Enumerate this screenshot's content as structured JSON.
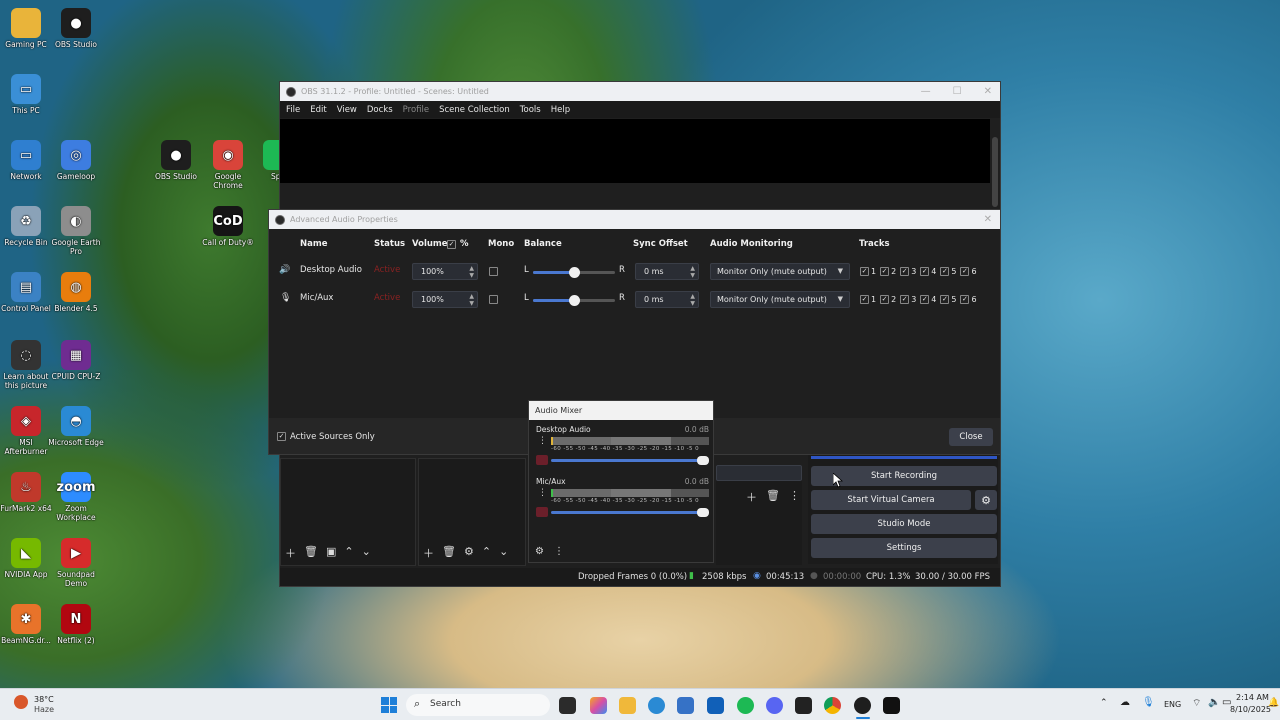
{
  "desktop_icons": [
    {
      "name": "desktop-icon-gaming-pc",
      "label": "Gaming PC",
      "glyph": "",
      "color": "#e9b43a"
    },
    {
      "name": "desktop-icon-obs-studio-1",
      "label": "OBS Studio",
      "glyph": "●",
      "color": "#1e1e1e"
    },
    {
      "name": "desktop-icon-this-pc",
      "label": "This PC",
      "glyph": "▭",
      "color": "#3a8fd6"
    },
    {
      "name": "desktop-icon-network",
      "label": "Network",
      "glyph": "▭",
      "color": "#2f7fd0"
    },
    {
      "name": "desktop-icon-gameloop",
      "label": "Gameloop",
      "glyph": "◎",
      "color": "#3d7de0"
    },
    {
      "name": "desktop-icon-obs-studio-2",
      "label": "OBS Studio",
      "glyph": "●",
      "color": "#1e1e1e"
    },
    {
      "name": "desktop-icon-google-chrome",
      "label": "Google Chrome",
      "glyph": "◉",
      "color": "#d9443a"
    },
    {
      "name": "desktop-icon-recycle-bin",
      "label": "Recycle Bin",
      "glyph": "♻",
      "color": "#8aa2b8"
    },
    {
      "name": "desktop-icon-google-earth-pro",
      "label": "Google Earth Pro",
      "glyph": "◐",
      "color": "#8d8d8d"
    },
    {
      "name": "desktop-icon-call-of-duty",
      "label": "Call of Duty®",
      "glyph": "CoD",
      "color": "#151515"
    },
    {
      "name": "desktop-icon-control-panel",
      "label": "Control Panel",
      "glyph": "▤",
      "color": "#3b82c4"
    },
    {
      "name": "desktop-icon-blender",
      "label": "Blender 4.5",
      "glyph": "◍",
      "color": "#e87d0d"
    },
    {
      "name": "desktop-icon-learn-about",
      "label": "Learn about this picture",
      "glyph": "◌",
      "color": "#333333"
    },
    {
      "name": "desktop-icon-cpuid",
      "label": "CPUID CPU-Z",
      "glyph": "▦",
      "color": "#6f2c91"
    },
    {
      "name": "desktop-icon-msi-afterburner",
      "label": "MSI Afterburner",
      "glyph": "◈",
      "color": "#c7262b"
    },
    {
      "name": "desktop-icon-microsoft-edge",
      "label": "Microsoft Edge",
      "glyph": "◓",
      "color": "#2a8ad4"
    },
    {
      "name": "desktop-icon-furmark",
      "label": "FurMark2 x64",
      "glyph": "♨",
      "color": "#c0392b"
    },
    {
      "name": "desktop-icon-zoom",
      "label": "Zoom Workplace",
      "glyph": "zoom",
      "color": "#2d8cff"
    },
    {
      "name": "desktop-icon-nvidia-app",
      "label": "NVIDIA App",
      "glyph": "◣",
      "color": "#76b900"
    },
    {
      "name": "desktop-icon-soundpad",
      "label": "Soundpad Demo",
      "glyph": "▶",
      "color": "#d62b2b"
    },
    {
      "name": "desktop-icon-beamng",
      "label": "BeamNG.dr...",
      "glyph": "✱",
      "color": "#e8732a"
    },
    {
      "name": "desktop-icon-netflix",
      "label": "Netflix (2)",
      "glyph": "N",
      "color": "#b20710"
    },
    {
      "name": "desktop-icon-spotify-partial",
      "label": "Spo",
      "glyph": "",
      "color": "#1db954"
    }
  ],
  "obs_window": {
    "title": "OBS 31.1.2 - Profile: Untitled - Scenes: Untitled",
    "menu": [
      "File",
      "Edit",
      "View",
      "Docks",
      "Profile",
      "Scene Collection",
      "Tools",
      "Help"
    ],
    "controls": {
      "start_recording": "Start Recording",
      "start_virtual_camera": "Start Virtual Camera",
      "studio_mode": "Studio Mode",
      "settings": "Settings"
    },
    "status": {
      "dropped_frames": "Dropped Frames 0 (0.0%)",
      "bitrate": "2508 kbps",
      "stream_time": "00:45:13",
      "rec_time": "00:00:00",
      "cpu": "CPU: 1.3%",
      "fps": "30.00 / 30.00 FPS"
    }
  },
  "advanced_audio": {
    "title": "Advanced Audio Properties",
    "headers": {
      "name": "Name",
      "status": "Status",
      "volume": "Volume",
      "percent": "%",
      "mono": "Mono",
      "balance": "Balance",
      "sync_offset": "Sync Offset",
      "audio_monitoring": "Audio Monitoring",
      "tracks": "Tracks"
    },
    "rows": [
      {
        "name": "Desktop Audio",
        "status": "Active",
        "volume": "100%",
        "balance_left": "L",
        "balance_right": "R",
        "balance": 0.5,
        "sync_offset": "0 ms",
        "monitoring": "Monitor Only (mute output)",
        "tracks": [
          "1",
          "2",
          "3",
          "4",
          "5",
          "6"
        ]
      },
      {
        "name": "Mic/Aux",
        "status": "Active",
        "volume": "100%",
        "balance_left": "L",
        "balance_right": "R",
        "balance": 0.5,
        "sync_offset": "0 ms",
        "monitoring": "Monitor Only (mute output)",
        "tracks": [
          "1",
          "2",
          "3",
          "4",
          "5",
          "6"
        ]
      }
    ],
    "active_sources_only": "Active Sources Only",
    "close": "Close"
  },
  "audio_mixer": {
    "title": "Audio Mixer",
    "channels": [
      {
        "name": "Desktop Audio",
        "db": "0.0 dB"
      },
      {
        "name": "Mic/Aux",
        "db": "0.0 dB"
      }
    ],
    "ticks": "-60 -55 -50 -45 -40 -35 -30 -25 -20 -15 -10 -5 0"
  },
  "taskbar": {
    "weather_temp": "38°C",
    "weather_desc": "Haze",
    "search": "Search",
    "lang": "ENG",
    "time": "2:14 AM",
    "date": "8/10/2025"
  }
}
